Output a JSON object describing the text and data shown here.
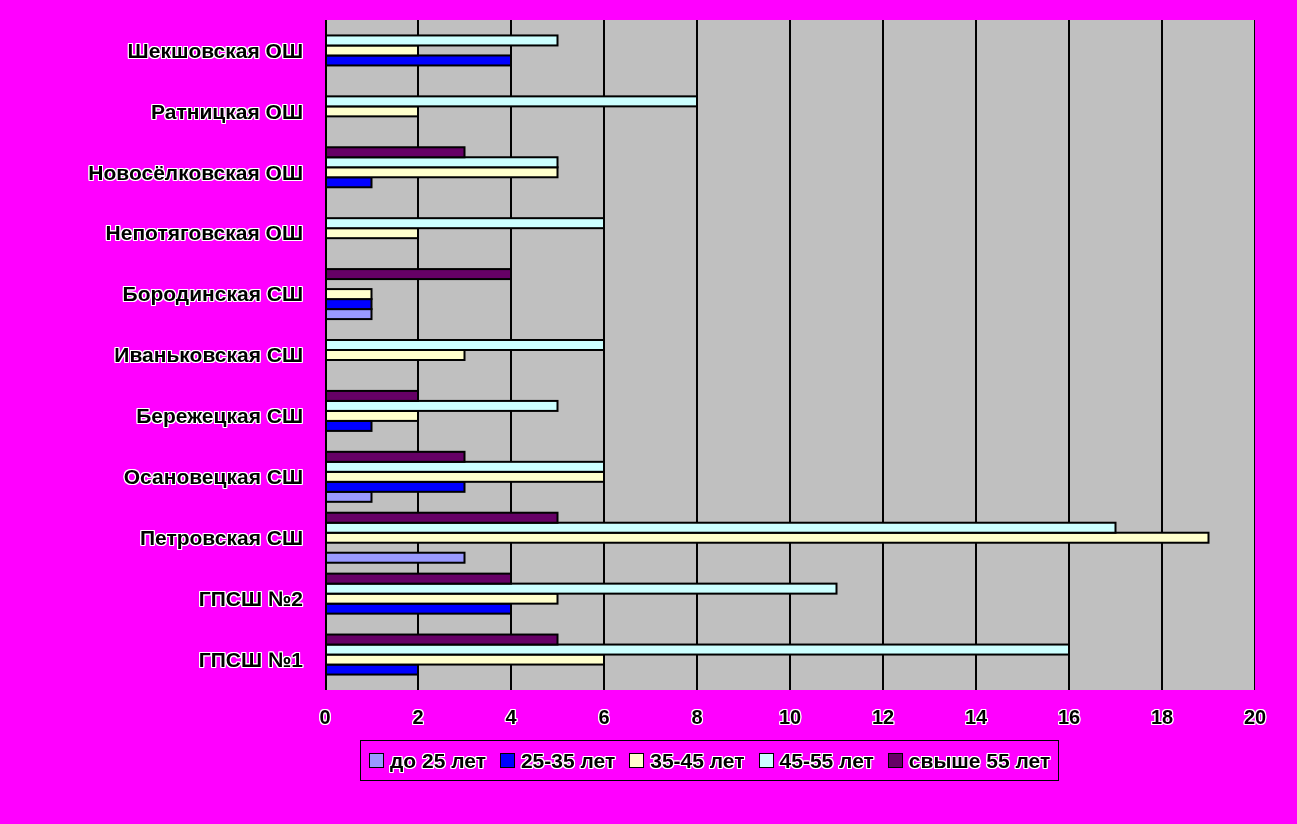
{
  "chart_data": {
    "type": "bar",
    "orientation": "horizontal",
    "grid": {
      "x": true
    },
    "legend": true,
    "categories": [
      "Шекшовская ОШ",
      "Ратницкая ОШ",
      "Новосёлковская ОШ",
      "Непотяговская ОШ",
      "Бородинская СШ",
      "Иваньковская СШ",
      "Бережецкая СШ",
      "Осановецкая СШ",
      "Петровская СШ",
      "ГПСШ №2",
      "ГПСШ №1"
    ],
    "xlim": [
      0,
      20
    ],
    "xticks": [
      {
        "value": 0,
        "label": "0"
      },
      {
        "value": 2,
        "label": "2"
      },
      {
        "value": 4,
        "label": "4"
      },
      {
        "value": 6,
        "label": "6"
      },
      {
        "value": 8,
        "label": "8"
      },
      {
        "value": 10,
        "label": "10"
      },
      {
        "value": 12,
        "label": "12"
      },
      {
        "value": 14,
        "label": "14"
      },
      {
        "value": 16,
        "label": "16"
      },
      {
        "value": 18,
        "label": "18"
      },
      {
        "value": 20,
        "label": "20"
      }
    ],
    "series": [
      {
        "name": "до 25 лет",
        "color": "#9999ff",
        "values": [
          0,
          0,
          0,
          0,
          1,
          0,
          0,
          1,
          3,
          0,
          0
        ]
      },
      {
        "name": "25-35 лет",
        "color": "#0000ff",
        "values": [
          4,
          0,
          1,
          0,
          1,
          0,
          1,
          3,
          0,
          4,
          2
        ]
      },
      {
        "name": "35-45 лет",
        "color": "#ffffcc",
        "values": [
          2,
          2,
          5,
          2,
          1,
          3,
          2,
          6,
          19,
          5,
          6
        ]
      },
      {
        "name": "45-55 лет",
        "color": "#ccffff",
        "values": [
          5,
          8,
          5,
          6,
          0,
          6,
          5,
          6,
          17,
          11,
          16
        ]
      },
      {
        "name": "свыше 55 лет",
        "color": "#660066",
        "values": [
          0,
          0,
          3,
          0,
          4,
          0,
          2,
          3,
          5,
          4,
          5
        ]
      }
    ]
  }
}
